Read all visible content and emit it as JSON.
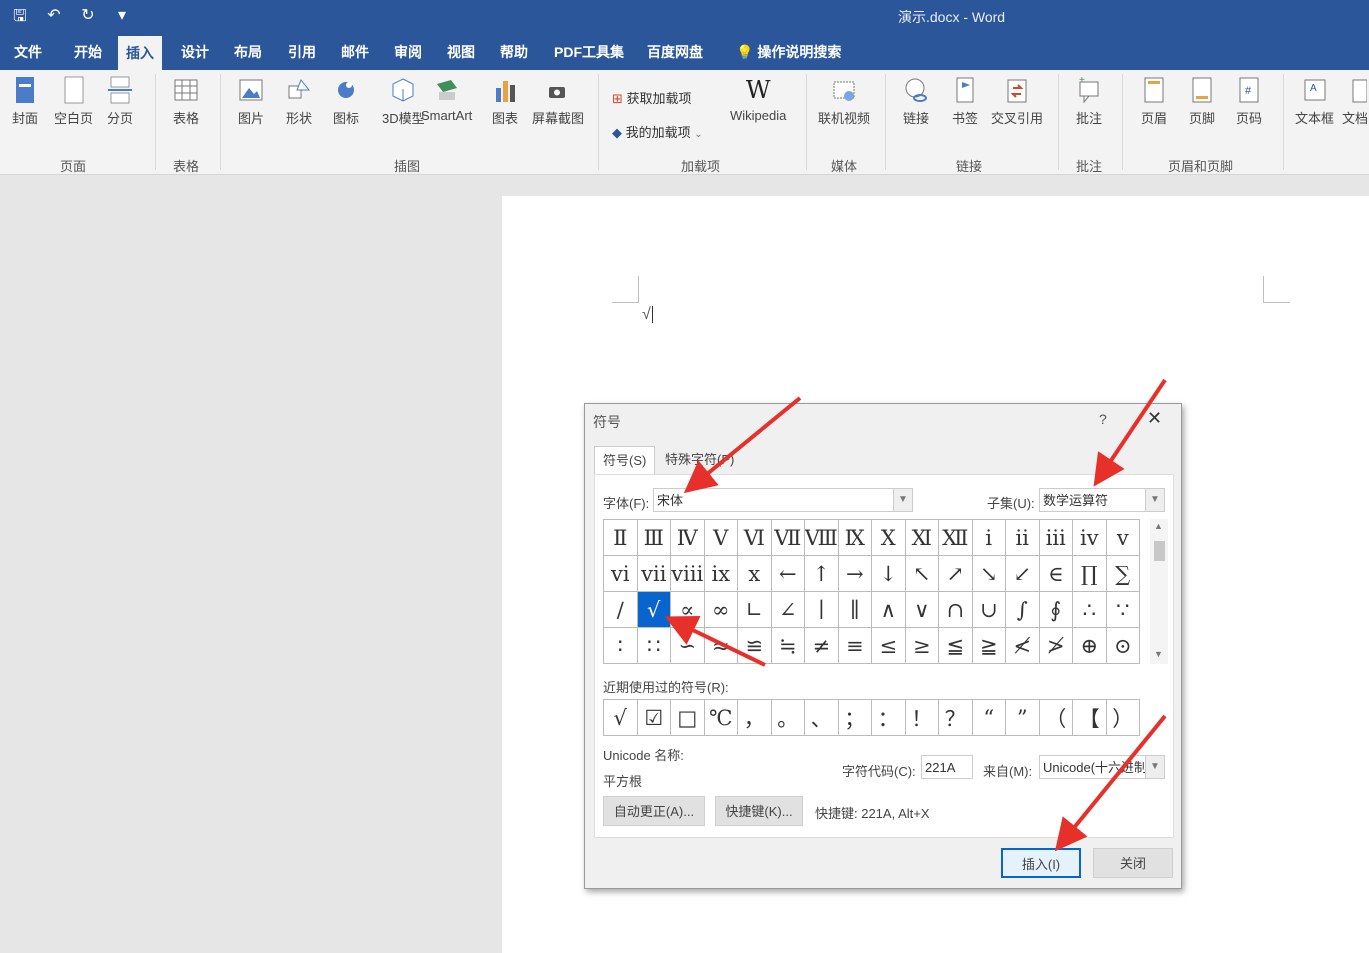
{
  "window": {
    "title": "演示.docx  -  Word"
  },
  "quick_access": [
    {
      "name": "save-icon",
      "glyph": "🖫"
    },
    {
      "name": "undo-icon",
      "glyph": "↶"
    },
    {
      "name": "redo-icon",
      "glyph": "↻"
    },
    {
      "name": "customize-icon",
      "glyph": "▾"
    }
  ],
  "tabs": [
    "文件",
    "开始",
    "插入",
    "设计",
    "布局",
    "引用",
    "邮件",
    "审阅",
    "视图",
    "帮助",
    "PDF工具集",
    "百度网盘",
    "操作说明搜索"
  ],
  "active_tab": "插入",
  "ribbon": {
    "groups": [
      "页面",
      "表格",
      "插图",
      "加载项",
      "媒体",
      "链接",
      "批注",
      "页眉和页脚"
    ],
    "buttons": [
      "封面",
      "空白页",
      "分页",
      "表格",
      "图片",
      "形状",
      "图标",
      "3D模型",
      "SmartArt",
      "图表",
      "屏幕截图",
      "Wikipedia",
      "联机视频",
      "链接",
      "书签",
      "交叉引用",
      "批注",
      "页眉",
      "页脚",
      "页码",
      "文本框",
      "文档"
    ],
    "addins": [
      "获取加载项",
      "我的加载项"
    ]
  },
  "document": {
    "cursor_text": "√"
  },
  "dialog": {
    "title": "符号",
    "help": "?",
    "close": "✕",
    "tabs": [
      "符号(S)",
      "特殊字符(P)"
    ],
    "font_label": "字体(F):",
    "font_value": "宋体",
    "subset_label": "子集(U):",
    "subset_value": "数学运算符",
    "symbols": [
      [
        "Ⅱ",
        "Ⅲ",
        "Ⅳ",
        "Ⅴ",
        "Ⅵ",
        "Ⅶ",
        "Ⅷ",
        "Ⅸ",
        "Ⅹ",
        "Ⅺ",
        "Ⅻ",
        "ⅰ",
        "ⅱ",
        "ⅲ",
        "ⅳ",
        "ⅴ"
      ],
      [
        "ⅵ",
        "ⅶ",
        "ⅷ",
        "ⅸ",
        "ⅹ",
        "←",
        "↑",
        "→",
        "↓",
        "↖",
        "↗",
        "↘",
        "↙",
        "∈",
        "∏",
        "∑"
      ],
      [
        "∕",
        "√",
        "∝",
        "∞",
        "∟",
        "∠",
        "∣",
        "∥",
        "∧",
        "∨",
        "∩",
        "∪",
        "∫",
        "∮",
        "∴",
        "∵"
      ],
      [
        "∶",
        "∷",
        "∽",
        "≈",
        "≌",
        "≒",
        "≠",
        "≡",
        "≤",
        "≥",
        "≦",
        "≧",
        "≮",
        "≯",
        "⊕",
        "⊙"
      ]
    ],
    "selected_symbol": "√",
    "recent_label": "近期使用过的符号(R):",
    "recent": [
      "√",
      "☑",
      "□",
      "℃",
      "，",
      "。",
      "、",
      "；",
      "：",
      "！",
      "？",
      "“",
      "”",
      "（",
      "【",
      "）"
    ],
    "unicode_name_label": "Unicode 名称:",
    "unicode_name": "平方根",
    "char_code_label": "字符代码(C):",
    "char_code": "221A",
    "from_label": "来自(M):",
    "from_value": "Unicode(十六进制)",
    "autocorrect": "自动更正(A)...",
    "shortcut_key": "快捷键(K)...",
    "shortcut_text": "快捷键: 221A, Alt+X",
    "insert": "插入(I)",
    "close_btn": "关闭"
  },
  "colors": {
    "accent": "#2b579a",
    "selection": "#0a64ce",
    "arrow": "#e8302a"
  }
}
